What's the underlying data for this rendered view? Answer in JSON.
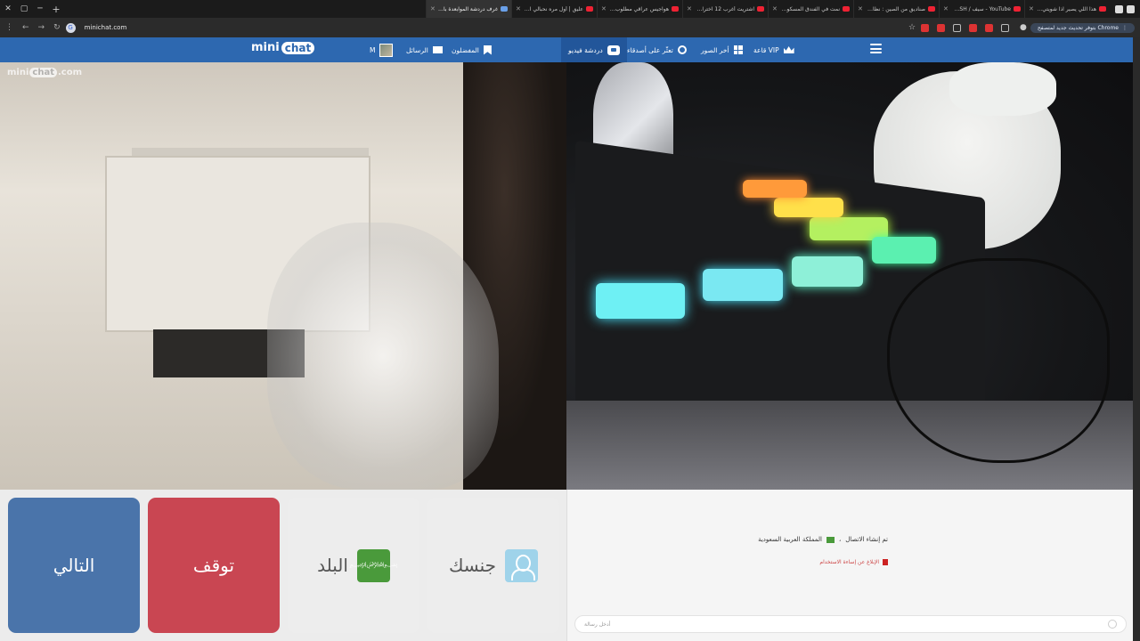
{
  "browser": {
    "tabs": [
      {
        "title": "هذا اللي يصير اذا شويتي طفشان"
      },
      {
        "title": "YouTube - سيف / BOOSH"
      },
      {
        "title": "صناديق من الصين : نظارة تبهاء"
      },
      {
        "title": "نمت في الفندق المسكون : أصوات"
      },
      {
        "title": "اشتريت أغرب 12 اختراع من ش..."
      },
      {
        "title": "هواجيس عراقي مطلوب ٧ - ٨٠"
      },
      {
        "title": "عليق | أول مره نحبالي ادرب مبار"
      },
      {
        "title": "غرف دردشة الموابعدة بالفيديو"
      }
    ],
    "url": "minichat.com",
    "update_pill": "بتوفر تحديث جديد لمتصفح Chrome"
  },
  "header": {
    "logo_mini": "mini",
    "logo_chat": "chat",
    "nav": {
      "video_chat": "دردشة فيديو",
      "search": "تعثّر على أصدقاء",
      "last_photos": "أخر الصور",
      "vip": "قاعة VIP",
      "favorites": "المفضلون",
      "messages": "الرسائل",
      "user": "M"
    }
  },
  "video": {
    "watermark_mini": "mini",
    "watermark_chat": "chat",
    "watermark_com": ".com"
  },
  "controls": {
    "next": "التالي",
    "stop": "توقف",
    "country": "البلد",
    "gender": "جنسك"
  },
  "chat": {
    "connected_prefix": "تم إنشاء الاتصال",
    "country_name": "المملكة العربية السعودية",
    "report": "الإبلاغ عن إساءة الاستخدام",
    "input_placeholder": "أدخل رسالة"
  },
  "colors": {
    "header_blue": "#2d68b0",
    "next_blue": "#4a74aa",
    "stop_red": "#c94652"
  }
}
